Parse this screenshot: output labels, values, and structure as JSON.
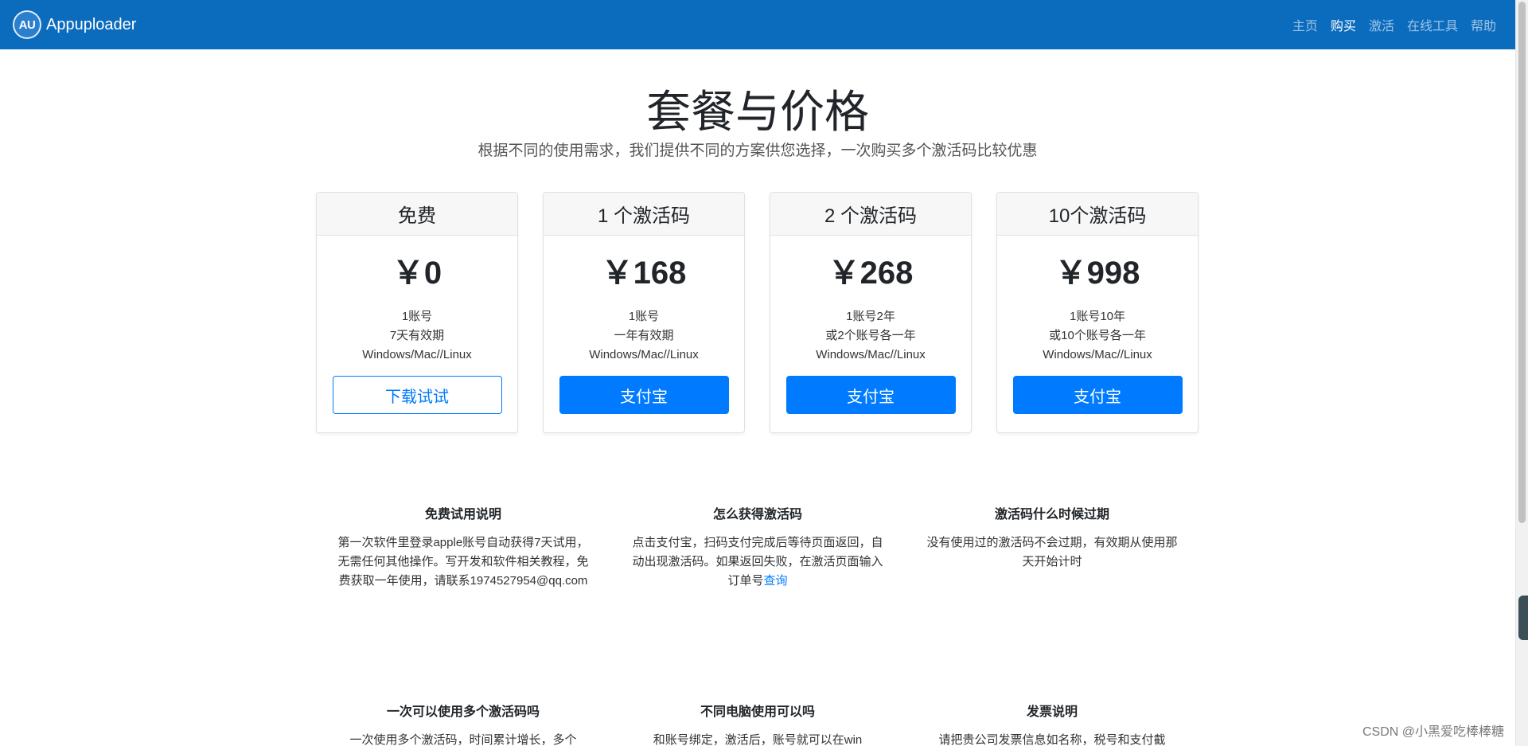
{
  "navbar": {
    "logo_text": "AU",
    "brand": "Appuploader",
    "links": [
      {
        "label": "主页"
      },
      {
        "label": "购买"
      },
      {
        "label": "激活"
      },
      {
        "label": "在线工具"
      },
      {
        "label": "帮助"
      }
    ],
    "active_link": "购买"
  },
  "header": {
    "title": "套餐与价格",
    "lead": "根据不同的使用需求，我们提供不同的方案供您选择，一次购买多个激活码比较优惠"
  },
  "plans": [
    {
      "name": "免费",
      "price": "￥0",
      "features": [
        "1账号",
        "7天有效期",
        "Windows/Mac//Linux"
      ],
      "button": "下载试试",
      "style": "outline"
    },
    {
      "name": "1 个激活码",
      "price": "￥168",
      "features": [
        "1账号",
        "一年有效期",
        "Windows/Mac//Linux"
      ],
      "button": "支付宝",
      "style": "solid"
    },
    {
      "name": "2 个激活码",
      "price": "￥268",
      "features": [
        "1账号2年",
        "或2个账号各一年",
        "Windows/Mac//Linux"
      ],
      "button": "支付宝",
      "style": "solid"
    },
    {
      "name": "10个激活码",
      "price": "￥998",
      "features": [
        "1账号10年",
        "或10个账号各一年",
        "Windows/Mac//Linux"
      ],
      "button": "支付宝",
      "style": "solid"
    }
  ],
  "faq": [
    {
      "title": "免费试用说明",
      "text": "第一次软件里登录apple账号自动获得7天试用，无需任何其他操作。写开发和软件相关教程，免费获取一年使用，请联系1974527954@qq.com"
    },
    {
      "title": "怎么获得激活码",
      "text": "点击支付宝，扫码支付完成后等待页面返回，自动出现激活码。如果返回失败，在激活页面输入订单号",
      "link": "查询"
    },
    {
      "title": "激活码什么时候过期",
      "text": "没有使用过的激活码不会过期，有效期从使用那天开始计时"
    },
    {
      "title": "一次可以使用多个激活码吗",
      "text": "一次使用多个激活码，时间累计增长，多个"
    },
    {
      "title": "不同电脑使用可以吗",
      "text": "和账号绑定，激活后，账号就可以在win"
    },
    {
      "title": "发票说明",
      "text": "请把贵公司发票信息如名称，税号和支付截"
    }
  ],
  "watermark": "CSDN @小黑爱吃棒棒糖",
  "colors": {
    "navbar": "#0b6bbd",
    "primary": "#007bff"
  }
}
